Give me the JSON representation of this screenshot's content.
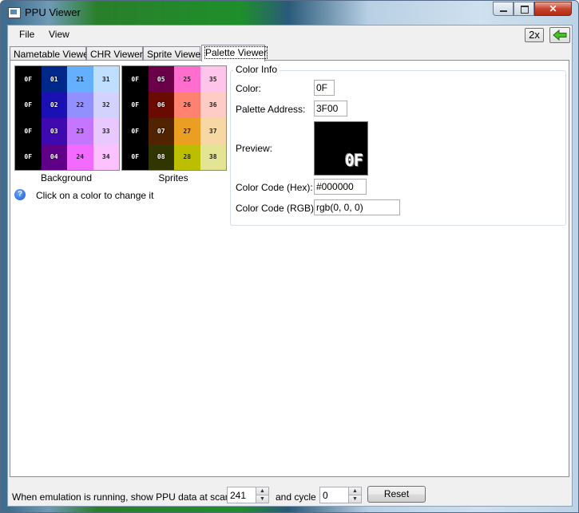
{
  "window": {
    "title": "PPU Viewer",
    "close_glyph": "✕"
  },
  "menu": {
    "items": [
      "File",
      "View"
    ]
  },
  "toolbar": {
    "scale_label": "2x"
  },
  "tabs": [
    "Nametable Viewer",
    "CHR Viewer",
    "Sprite Viewer",
    "Palette Viewer"
  ],
  "background_palette": {
    "label": "Background",
    "cells": [
      {
        "code": "0F",
        "color": "#000000",
        "text": "dark"
      },
      {
        "code": "01",
        "color": "#00278a",
        "text": "dark"
      },
      {
        "code": "21",
        "color": "#64b0ff",
        "text": "light"
      },
      {
        "code": "31",
        "color": "#c0dfff",
        "text": "light"
      },
      {
        "code": "0F",
        "color": "#000000",
        "text": "dark"
      },
      {
        "code": "02",
        "color": "#1a10b4",
        "text": "dark"
      },
      {
        "code": "22",
        "color": "#9290ff",
        "text": "light"
      },
      {
        "code": "32",
        "color": "#d3d2ff",
        "text": "light"
      },
      {
        "code": "0F",
        "color": "#000000",
        "text": "dark"
      },
      {
        "code": "03",
        "color": "#3e0ab0",
        "text": "dark"
      },
      {
        "code": "23",
        "color": "#c576ff",
        "text": "light"
      },
      {
        "code": "33",
        "color": "#e8c8ff",
        "text": "light"
      },
      {
        "code": "0F",
        "color": "#000000",
        "text": "dark"
      },
      {
        "code": "04",
        "color": "#600088",
        "text": "dark"
      },
      {
        "code": "24",
        "color": "#f26aff",
        "text": "light"
      },
      {
        "code": "34",
        "color": "#fbc2ff",
        "text": "light"
      }
    ]
  },
  "sprite_palette": {
    "label": "Sprites",
    "cells": [
      {
        "code": "0F",
        "color": "#000000",
        "text": "dark"
      },
      {
        "code": "05",
        "color": "#6a0048",
        "text": "dark"
      },
      {
        "code": "25",
        "color": "#ff6ecc",
        "text": "light"
      },
      {
        "code": "35",
        "color": "#ffc4ea",
        "text": "light"
      },
      {
        "code": "0F",
        "color": "#000000",
        "text": "dark"
      },
      {
        "code": "06",
        "color": "#6a0a00",
        "text": "dark"
      },
      {
        "code": "26",
        "color": "#ff8170",
        "text": "light"
      },
      {
        "code": "36",
        "color": "#ffccc5",
        "text": "light"
      },
      {
        "code": "0F",
        "color": "#000000",
        "text": "dark"
      },
      {
        "code": "07",
        "color": "#522300",
        "text": "dark"
      },
      {
        "code": "27",
        "color": "#ea9e22",
        "text": "light"
      },
      {
        "code": "37",
        "color": "#f7d8a5",
        "text": "light"
      },
      {
        "code": "0F",
        "color": "#000000",
        "text": "dark"
      },
      {
        "code": "08",
        "color": "#313600",
        "text": "dark"
      },
      {
        "code": "28",
        "color": "#bcbe00",
        "text": "light"
      },
      {
        "code": "38",
        "color": "#e4e594",
        "text": "light"
      }
    ]
  },
  "help": {
    "icon": "help-icon",
    "text": "Click on a color to change it"
  },
  "color_info": {
    "legend": "Color Info",
    "color_label": "Color:",
    "color_value": "0F",
    "address_label": "Palette Address:",
    "address_value": "3F00",
    "preview_label": "Preview:",
    "preview_text": "0F",
    "hex_label": "Color Code (Hex):",
    "hex_value": "#000000",
    "rgb_label": "Color Code (RGB):",
    "rgb_value": "rgb(0, 0, 0)"
  },
  "status": {
    "text1": "When emulation is running, show PPU data at scanline",
    "scanline": "241",
    "text2": "and cycle",
    "cycle": "0",
    "reset_label": "Reset"
  }
}
